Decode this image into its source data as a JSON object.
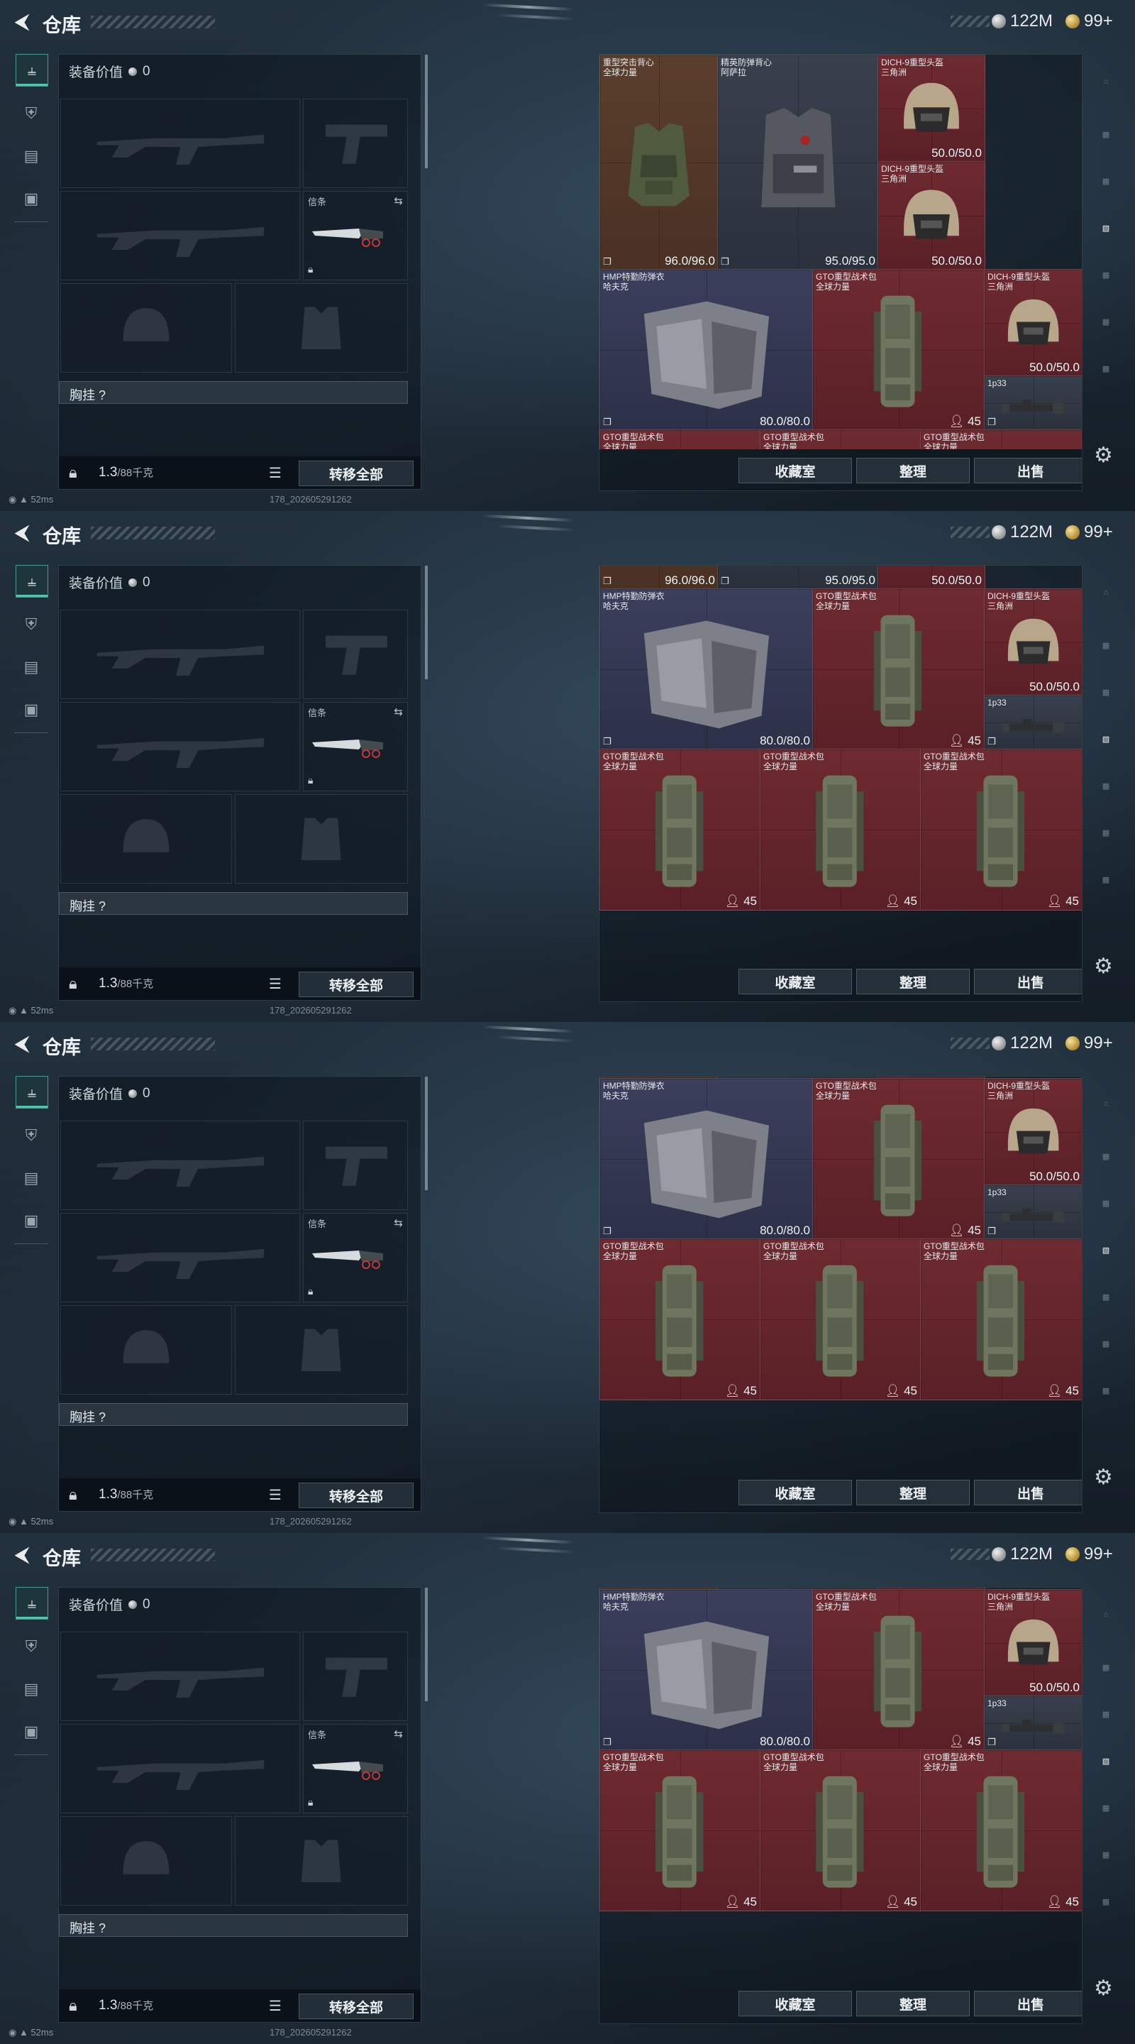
{
  "frames": [
    {
      "variant": "top"
    },
    {
      "variant": "scrolled1"
    },
    {
      "variant": "scrolled2"
    },
    {
      "variant": "scrolled2"
    }
  ],
  "header": {
    "back_icon": "chevron-left-icon",
    "title": "仓库",
    "silver_amount": "122M",
    "gold_amount": "99+"
  },
  "loadout": {
    "equip_value_label": "装备价值",
    "equip_value": "0",
    "melee_slot_label": "信条",
    "chest_rig_label": "胸挂 ?",
    "weight": "1.3",
    "weight_max": "/88千克",
    "transfer_all_label": "转移全部"
  },
  "status": {
    "ping": "52ms",
    "build_id": "178_202605291262"
  },
  "storage": {
    "buttons": {
      "collection": "收藏室",
      "sort": "整理",
      "sell": "出售"
    },
    "items": {
      "heavy_vest": {
        "name": "重型突击背心\n全球力量",
        "durability": "96.0/96.0"
      },
      "elite_vest": {
        "name": "精英防弹背心\n阿萨拉",
        "durability": "95.0/95.0"
      },
      "dich_helmet": {
        "name": "DICH-9重型头盔\n三角洲",
        "durability": "50.0/50.0"
      },
      "hmp_armor": {
        "name": "HMP特勤防弹衣\n哈夫克",
        "durability": "80.0/80.0"
      },
      "gto_pack": {
        "name": "GTO重型战术包\n全球力量",
        "capacity": "45"
      },
      "scope": {
        "name": "1p33"
      }
    }
  },
  "colors": {
    "accent_teal": "#54c4a8",
    "cell_red": "#6e2a30",
    "cell_brown": "#5b3e2c",
    "cell_blue": "#3b3f5c"
  }
}
